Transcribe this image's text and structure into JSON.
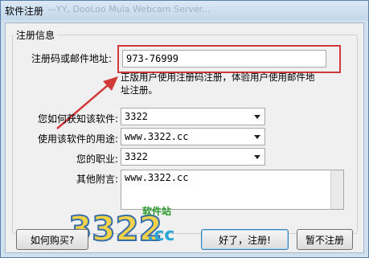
{
  "window": {
    "title": "软件注册",
    "ghost_title": "—YY, DooLoo Mula Webcam Server..."
  },
  "group": {
    "title": "注册信息"
  },
  "form": {
    "reg_code_label": "注册码或邮件地址:",
    "reg_code_value": "973-76999",
    "hint_line1": "正版用户使用注册码注册，体验用户使用邮件地",
    "hint_line2": "址注册。",
    "source_label": "您如何获知该软件:",
    "source_value": "3322",
    "usage_label": "使用该软件的用途:",
    "usage_value": "www.3322.cc",
    "job_label": "您的职业:",
    "job_value": "3322",
    "notes_label": "其他附言:",
    "notes_value": "www.3322.cc"
  },
  "buttons": {
    "how_to_buy": "如何购买?",
    "register": "好了，注册!",
    "later": "暂不注册"
  },
  "watermark": {
    "main": "3322",
    "cc": ".cc",
    "sub": "软件站"
  },
  "colors": {
    "highlight": "#d23a3a",
    "arrow": "#d23a3a"
  }
}
